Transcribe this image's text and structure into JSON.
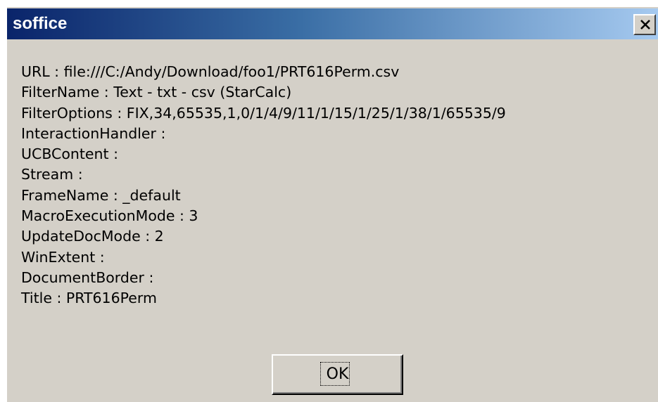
{
  "window": {
    "title": "soffice"
  },
  "message_lines": [
    "URL : file:///C:/Andy/Download/foo1/PRT616Perm.csv",
    "FilterName : Text - txt - csv (StarCalc)",
    "FilterOptions : FIX,34,65535,1,0/1/4/9/11/1/15/1/25/1/38/1/65535/9",
    "InteractionHandler :",
    "UCBContent :",
    "Stream :",
    "FrameName : _default",
    "MacroExecutionMode : 3",
    "UpdateDocMode : 2",
    "WinExtent :",
    "DocumentBorder :",
    "Title : PRT616Perm"
  ],
  "buttons": {
    "ok_label": "OK"
  },
  "icons": {
    "close": "close-icon"
  },
  "colors": {
    "dialog_face": "#d4d0c8",
    "titlebar_start": "#0a246a",
    "titlebar_end": "#a6caf0",
    "title_text": "#ffffff"
  }
}
